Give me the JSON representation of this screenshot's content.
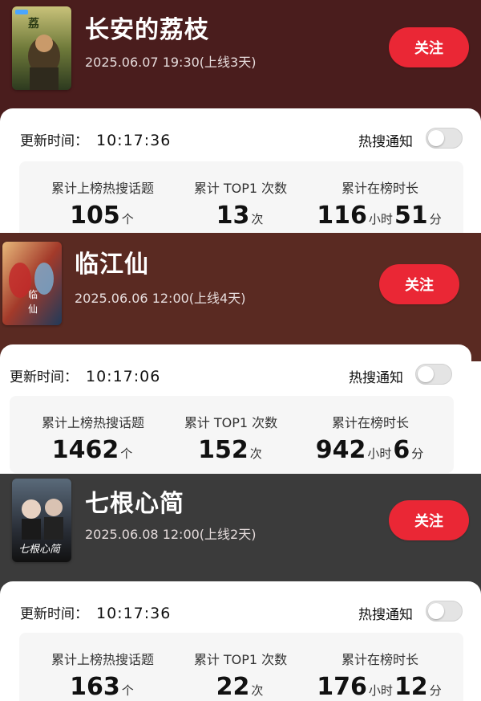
{
  "cards": [
    {
      "title": "长安的荔枝",
      "date": "2025.06.07 19:30(上线3天)",
      "follow": "关注",
      "update_label": "更新时间：",
      "update_time": "10:17:36",
      "notify_label": "热搜通知",
      "header_color": "#4a1d1d",
      "stats": [
        {
          "label": "累计上榜热搜话题",
          "value": "105",
          "unit": "个"
        },
        {
          "label": "累计 TOP1 次数",
          "value": "13",
          "unit": "次"
        },
        {
          "label": "累计在榜时长",
          "hours": "116",
          "hours_unit": "小时",
          "minutes": "51",
          "minutes_unit": "分"
        }
      ]
    },
    {
      "title": "临江仙",
      "date": "2025.06.06 12:00(上线4天)",
      "follow": "关注",
      "update_label": "更新时间：",
      "update_time": "10:17:06",
      "notify_label": "热搜通知",
      "header_color": "#5a2a22",
      "stats": [
        {
          "label": "累计上榜热搜话题",
          "value": "1462",
          "unit": "个"
        },
        {
          "label": "累计 TOP1 次数",
          "value": "152",
          "unit": "次"
        },
        {
          "label": "累计在榜时长",
          "hours": "942",
          "hours_unit": "小时",
          "minutes": "6",
          "minutes_unit": "分"
        }
      ]
    },
    {
      "title": "七根心简",
      "date": "2025.06.08 12:00(上线2天)",
      "follow": "关注",
      "update_label": "更新时间：",
      "update_time": "10:17:36",
      "notify_label": "热搜通知",
      "header_color": "#3b3b3b",
      "stats": [
        {
          "label": "累计上榜热搜话题",
          "value": "163",
          "unit": "个"
        },
        {
          "label": "累计 TOP1 次数",
          "value": "22",
          "unit": "次"
        },
        {
          "label": "累计在榜时长",
          "hours": "176",
          "hours_unit": "小时",
          "minutes": "12",
          "minutes_unit": "分"
        }
      ]
    }
  ]
}
